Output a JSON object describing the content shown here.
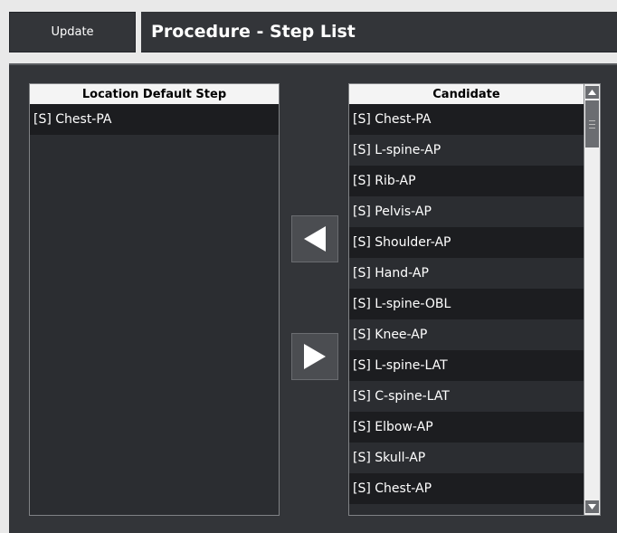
{
  "header": {
    "update_label": "Update",
    "title": "Procedure - Step List"
  },
  "left_list": {
    "header": "Location Default Step",
    "items": [
      "[S] Chest-PA"
    ]
  },
  "right_list": {
    "header": "Candidate",
    "items": [
      "[S] Chest-PA",
      "[S] L-spine-AP",
      "[S] Rib-AP",
      "[S] Pelvis-AP",
      "[S] Shoulder-AP",
      "[S] Hand-AP",
      "[S] L-spine-OBL",
      "[S] Knee-AP",
      "[S] L-spine-LAT",
      "[S] C-spine-LAT",
      "[S] Elbow-AP",
      "[S] Skull-AP",
      "[S] Chest-AP"
    ]
  },
  "buttons": {
    "move_left_icon": "triangle-left-icon",
    "move_right_icon": "triangle-right-icon"
  },
  "colors": {
    "panel_bg": "#333539",
    "row_dark": "#1c1d20",
    "row_light": "#2b2d31",
    "header_bg": "#f4f4f4"
  }
}
